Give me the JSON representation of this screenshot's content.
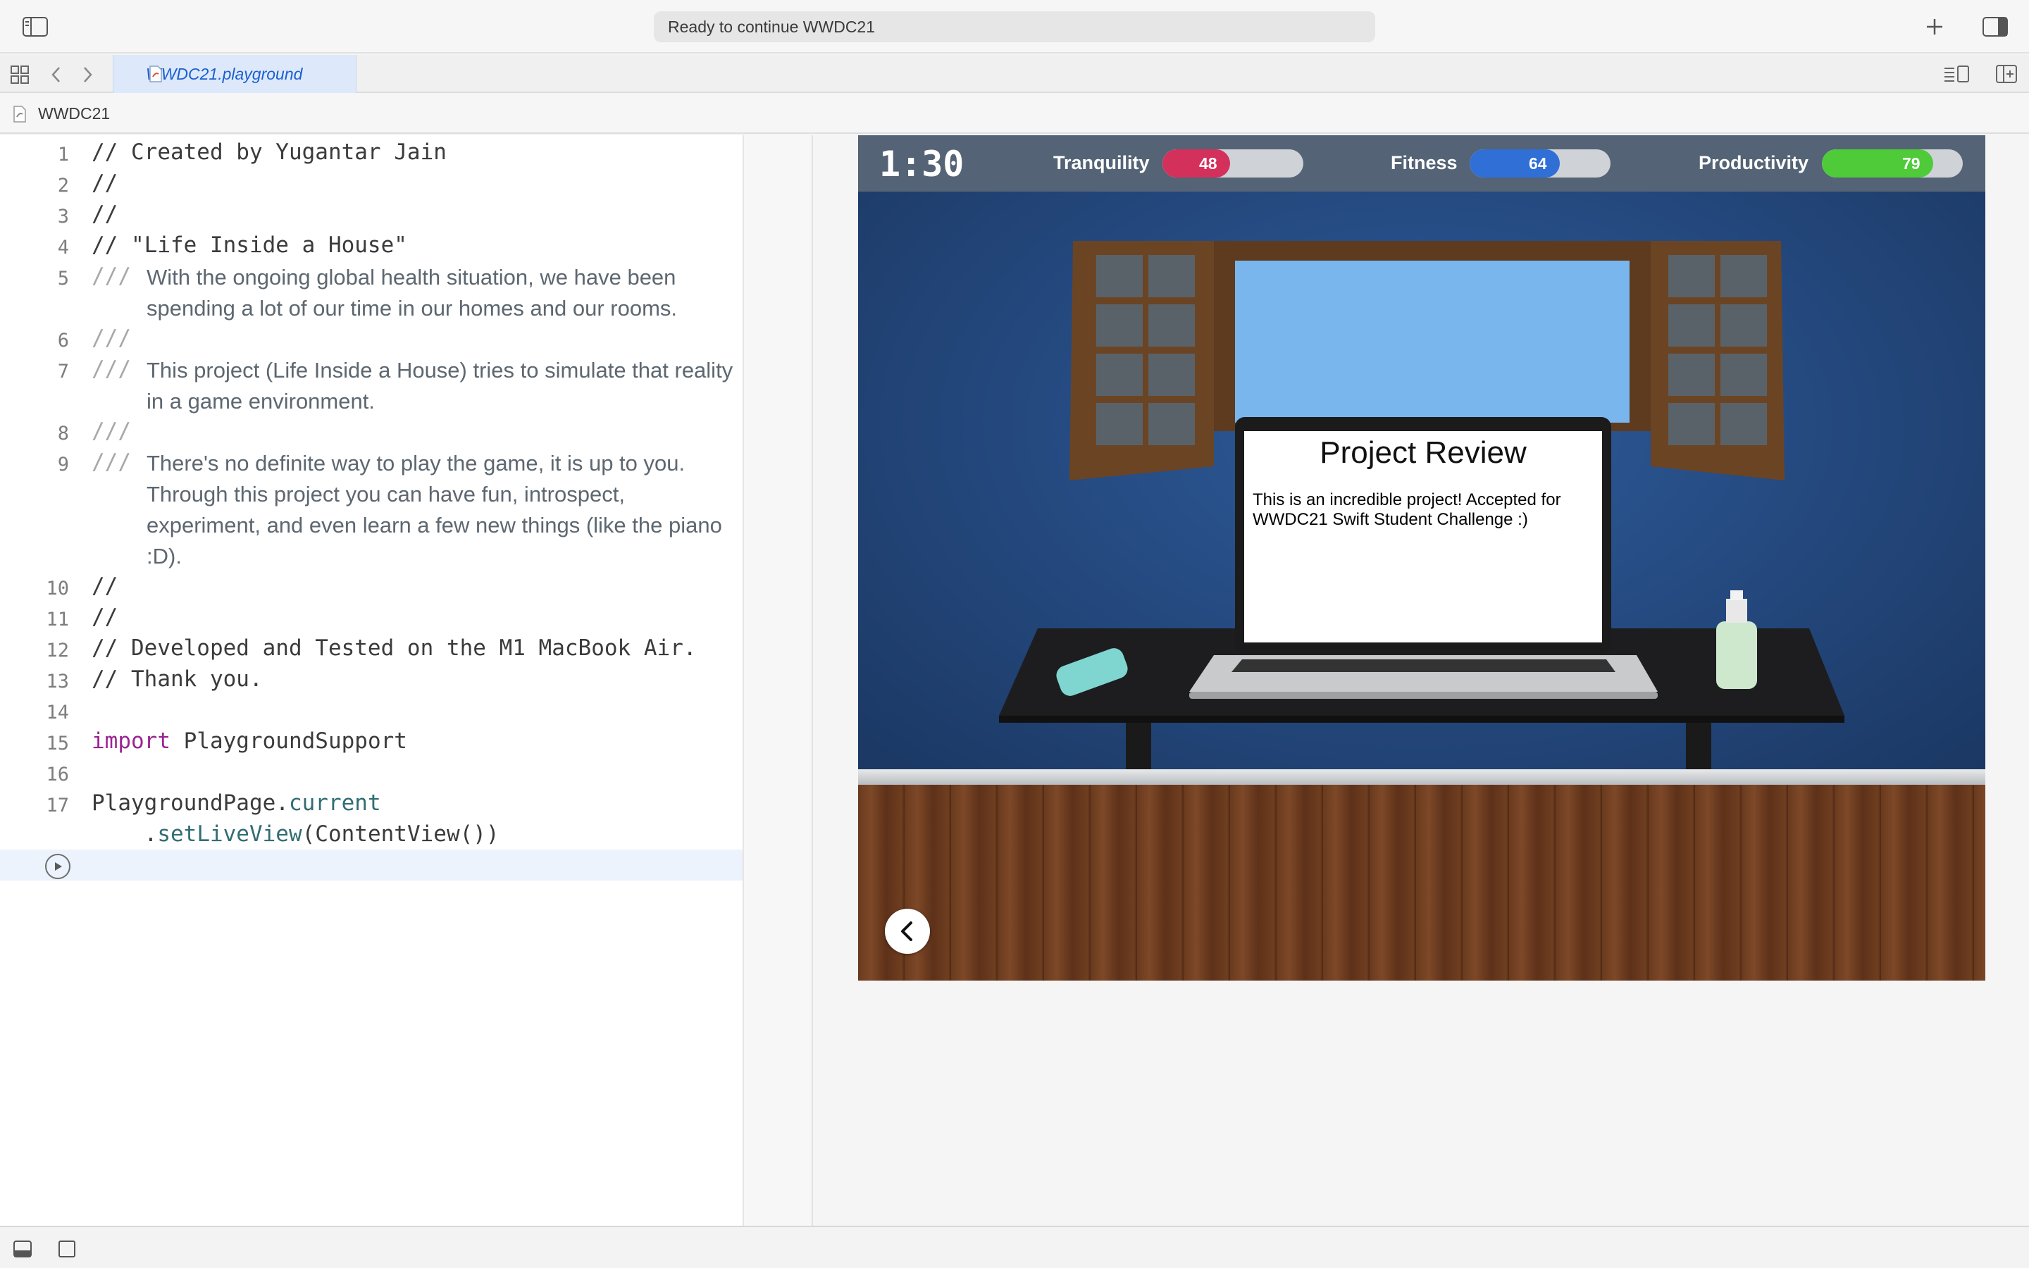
{
  "titlebar": {
    "status": "Ready to continue WWDC21",
    "icons": [
      "sidebar-toggle-icon",
      "plus-icon",
      "inspector-toggle-icon"
    ]
  },
  "tabbar": {
    "tab_label": "WWDC21.playground",
    "icons": [
      "grid-icon",
      "chevron-left-icon",
      "chevron-right-icon",
      "editor-options-icon",
      "add-editor-icon"
    ]
  },
  "jumpbar": {
    "crumb": "WWDC21"
  },
  "editor": {
    "lines": [
      {
        "n": "1",
        "text": "// Created by Yugantar Jain"
      },
      {
        "n": "2",
        "text": "//"
      },
      {
        "n": "3",
        "text": "//"
      },
      {
        "n": "4",
        "text": "// \"Life Inside a House\""
      },
      {
        "n": "5",
        "marker": "///",
        "doc": "With the ongoing global health situation, we have been spending a lot of our time in our homes and our rooms."
      },
      {
        "n": "6",
        "marker": "///"
      },
      {
        "n": "7",
        "marker": "///",
        "doc": "This project (Life Inside a House) tries to simulate that reality in a game environment."
      },
      {
        "n": "8",
        "marker": "///"
      },
      {
        "n": "9",
        "marker": "///",
        "doc": "There's no definite way to play the game, it is up to you. Through this project you can have fun, introspect, experiment, and even learn a few new things (like the piano :D)."
      },
      {
        "n": "10",
        "text": "//"
      },
      {
        "n": "11",
        "text": "//"
      },
      {
        "n": "12",
        "text": "// Developed and Tested on the M1 MacBook Air."
      },
      {
        "n": "13",
        "text": "// Thank you."
      },
      {
        "n": "14",
        "text": ""
      },
      {
        "n": "15",
        "kw": "import",
        "rest": " PlaygroundSupport"
      },
      {
        "n": "16",
        "text": ""
      },
      {
        "n": "17",
        "code_a": "PlaygroundPage.",
        "code_b": "current",
        "code_c": "    .",
        "code_d": "setLiveView",
        "code_e": "(ContentView())"
      }
    ]
  },
  "liveview": {
    "timer": "1:30",
    "stats": [
      {
        "label": "Tranquility",
        "value": 48,
        "color": "#d4305c"
      },
      {
        "label": "Fitness",
        "value": 64,
        "color": "#2f6fd6"
      },
      {
        "label": "Productivity",
        "value": 79,
        "color": "#4fcb3a"
      }
    ],
    "review_title": "Project Review",
    "review_body": "This is an incredible project! Accepted for WWDC21 Swift Student Challenge :)"
  },
  "bottombar": {
    "icons": [
      "console-toggle-icon",
      "debug-area-icon"
    ]
  }
}
